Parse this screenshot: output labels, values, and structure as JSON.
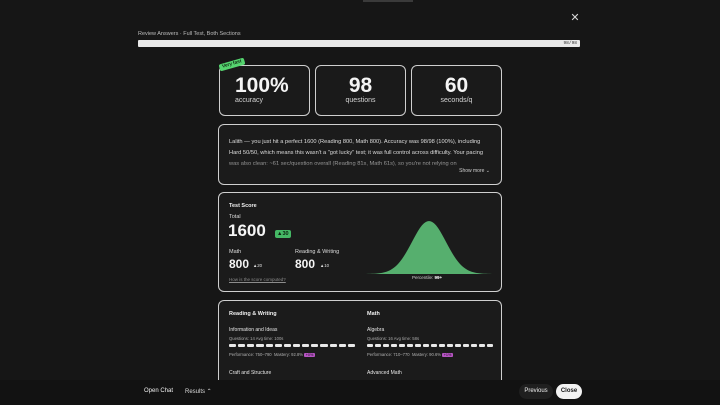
{
  "header": {
    "title": "Review Answers · Full Test, Both Sections",
    "progress_label": "98/98",
    "progress_fraction": 1.0,
    "close_icon": "close-icon"
  },
  "stats": {
    "ribbon": "Very fast",
    "accuracy_value": "100%",
    "accuracy_label": "accuracy",
    "questions_value": "98",
    "questions_label": "questions",
    "pace_value": "60",
    "pace_label": "seconds/q"
  },
  "summary": {
    "text": "Lalith — you just hit a perfect 1600 (Reading 800, Math 800). Accuracy was 98/98 (100%), including Hard 50/50, which means this wasn't a \"got lucky\" test; it was full control across difficulty. Your pacing was also clean: ~61 sec/question overall (Reading 81s, Math 61s), so you're not relying on",
    "show_more": "Show more ⌄"
  },
  "score": {
    "title": "Test Score",
    "total_label": "Total",
    "total_value": "1600",
    "total_delta": "▲30",
    "math_label": "Math",
    "math_value": "800",
    "math_delta": "▲20",
    "rw_label": "Reading & Writing",
    "rw_value": "800",
    "rw_delta": "▲10",
    "how_link": "How is the score computed?",
    "percentile_label": "Percentile:",
    "percentile_value": "99+",
    "curve_color": "#5fc47a"
  },
  "sections": {
    "rw": {
      "title": "Reading & Writing",
      "domain": "Information and Ideas",
      "meta": "Questions: 14   Avg time: 100s",
      "performance": "Performance: 750–790",
      "mastery": "Mastery: 92.8%",
      "chip": "+0%",
      "next_domain": "Craft and Structure"
    },
    "math": {
      "title": "Math",
      "domain": "Algebra",
      "meta": "Questions: 16   Avg time: 58s",
      "performance": "Performance: 710–770",
      "mastery": "Mastery: 90.6%",
      "chip": "+1%",
      "next_domain": "Advanced Math"
    }
  },
  "footer": {
    "open_chat": "Open Chat",
    "results": "Results ⌃",
    "previous": "Previous",
    "close": "Close"
  }
}
